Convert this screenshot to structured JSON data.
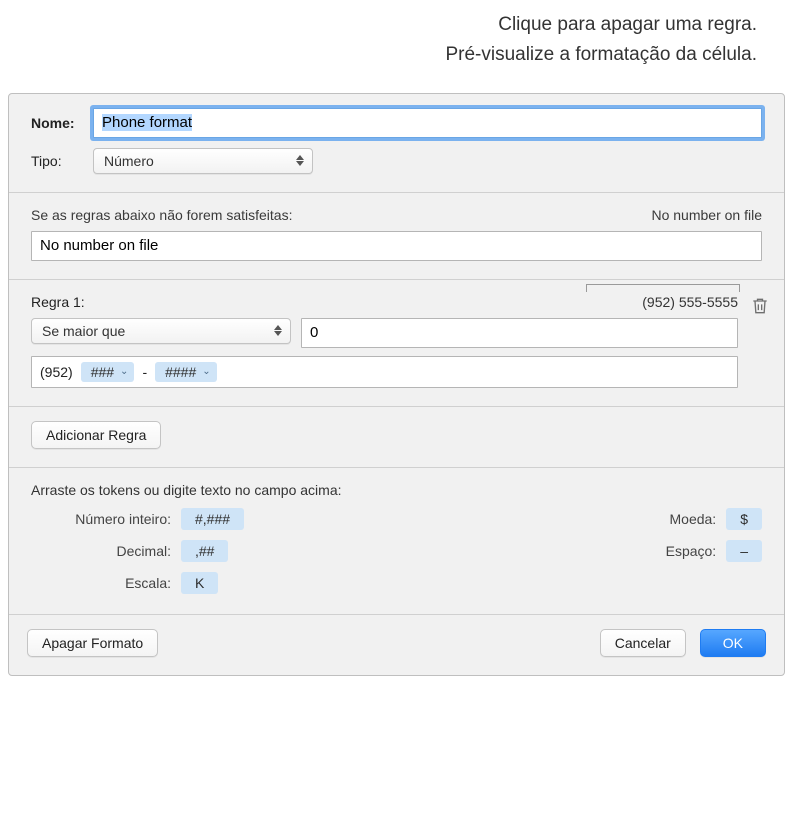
{
  "callouts": {
    "delete": "Clique para apagar uma regra.",
    "preview": "Pré-visualize a formatação da célula."
  },
  "nameRow": {
    "label": "Nome:",
    "value": "Phone format"
  },
  "typeRow": {
    "label": "Tipo:",
    "selected": "Número"
  },
  "fallback": {
    "label": "Se as regras abaixo não forem satisfeitas:",
    "preview": "No number on file",
    "value": "No number on file"
  },
  "rule1": {
    "name": "Regra 1:",
    "preview": "(952) 555-5555",
    "condition": "Se maior que",
    "compareValue": "0",
    "formatSegments": {
      "prefix": "(952)",
      "token1": "###",
      "sep": "-",
      "token2": "####"
    }
  },
  "addRuleLabel": "Adicionar Regra",
  "tokensHelp": {
    "title": "Arraste os tokens ou digite texto no campo acima:",
    "integer": {
      "label": "Número inteiro:",
      "token": "#,###"
    },
    "decimal": {
      "label": "Decimal:",
      "token": ",##"
    },
    "scale": {
      "label": "Escala:",
      "token": "K"
    },
    "currency": {
      "label": "Moeda:",
      "token": "$"
    },
    "space": {
      "label": "Espaço:",
      "token": "–"
    }
  },
  "footer": {
    "deleteFormat": "Apagar Formato",
    "cancel": "Cancelar",
    "ok": "OK"
  }
}
